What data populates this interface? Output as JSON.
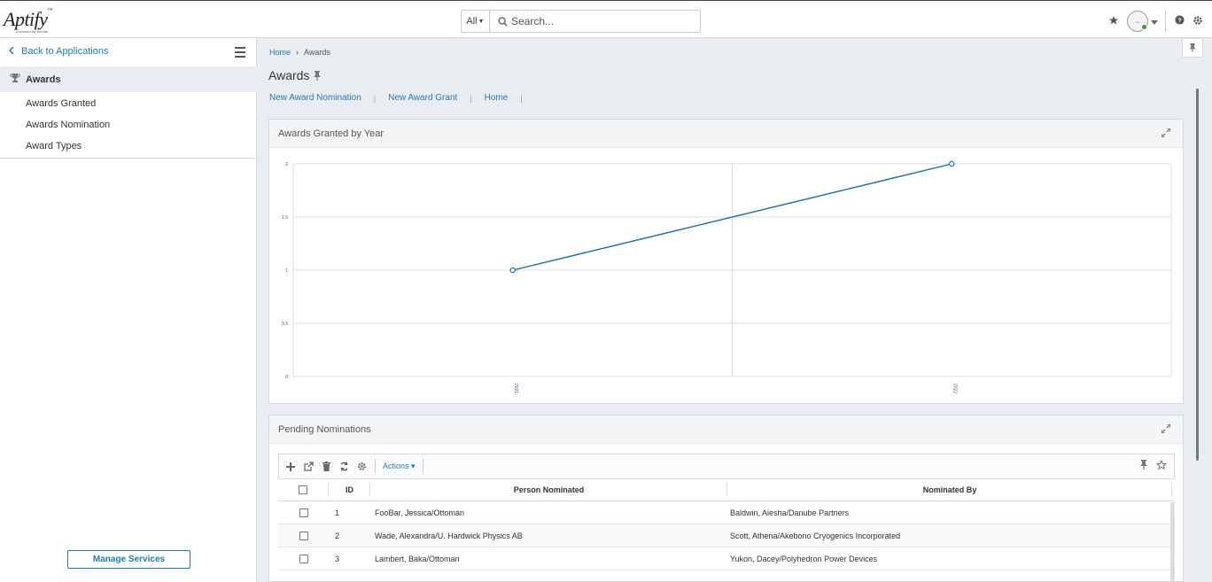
{
  "app": {
    "logo_text": "Aptify",
    "logo_sub": "a community brands",
    "search_scope": "All",
    "search_placeholder": "Search..."
  },
  "sidebar": {
    "back_label": "Back to Applications",
    "active_item": "Awards",
    "items": [
      "Awards Granted",
      "Awards Nomination",
      "Award Types"
    ],
    "manage_label": "Manage Services"
  },
  "main": {
    "breadcrumb": [
      "Home",
      "Awards"
    ],
    "title": "Awards",
    "links": [
      "New Award Nomination",
      "New Award Grant",
      "Home"
    ]
  },
  "chart_card": {
    "title": "Awards Granted by Year"
  },
  "chart_data": {
    "type": "line",
    "title": "Awards Granted by Year",
    "categories": [
      "2021",
      "2022"
    ],
    "series": [
      {
        "values": [
          1,
          2
        ]
      }
    ],
    "y_ticks": [
      "0",
      "0.5",
      "1",
      "1.5",
      "2"
    ],
    "ylim": [
      0,
      2
    ],
    "grid": true,
    "color": "#1f6fa8"
  },
  "table_card": {
    "title": "Pending Nominations",
    "actions_label": "Actions",
    "columns": [
      "ID",
      "Person Nominated",
      "Nominated By"
    ],
    "rows": [
      {
        "id": "1",
        "person": "FooBar, Jessica/Ottoman",
        "by": "Baldwin, Aiesha/Danube Partners"
      },
      {
        "id": "2",
        "person": "Wade, Alexandra/U. Hardwick Physics AB",
        "by": "Scott, Athena/Akebono Cryogenics Incorporated"
      },
      {
        "id": "3",
        "person": "Lambert, Baka/Ottoman",
        "by": "Yukon, Dacey/Polyhedron Power Devices"
      }
    ]
  },
  "colors": {
    "accent": "#1f7ab8",
    "status_online": "#2aa03c"
  }
}
